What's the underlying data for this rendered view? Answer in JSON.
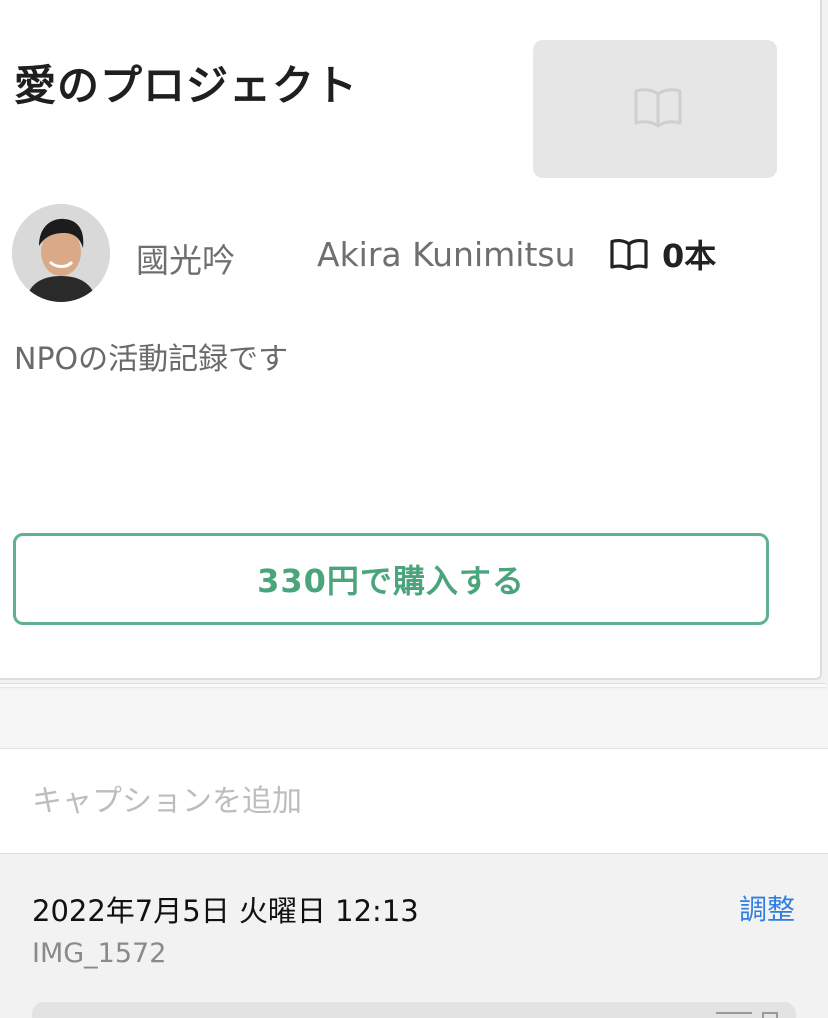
{
  "product": {
    "title": "愛のプロジェクト",
    "cover_icon": "book-open-icon",
    "author_name_ja": "國光吟",
    "author_name_en": "Akira Kunimitsu",
    "book_count_icon": "book-open-icon",
    "book_count": "0本",
    "description": "NPOの活動記録です",
    "buy_label": "330円で購入する"
  },
  "photo_info": {
    "caption_placeholder": "キャプションを追加",
    "caption_value": "",
    "datetime": "2022年7月5日 火曜日 12:13",
    "adjust_label": "調整",
    "filename": "IMG_1572"
  },
  "colors": {
    "accent_green": "#4aa57c",
    "link_blue": "#2f7ee0"
  }
}
